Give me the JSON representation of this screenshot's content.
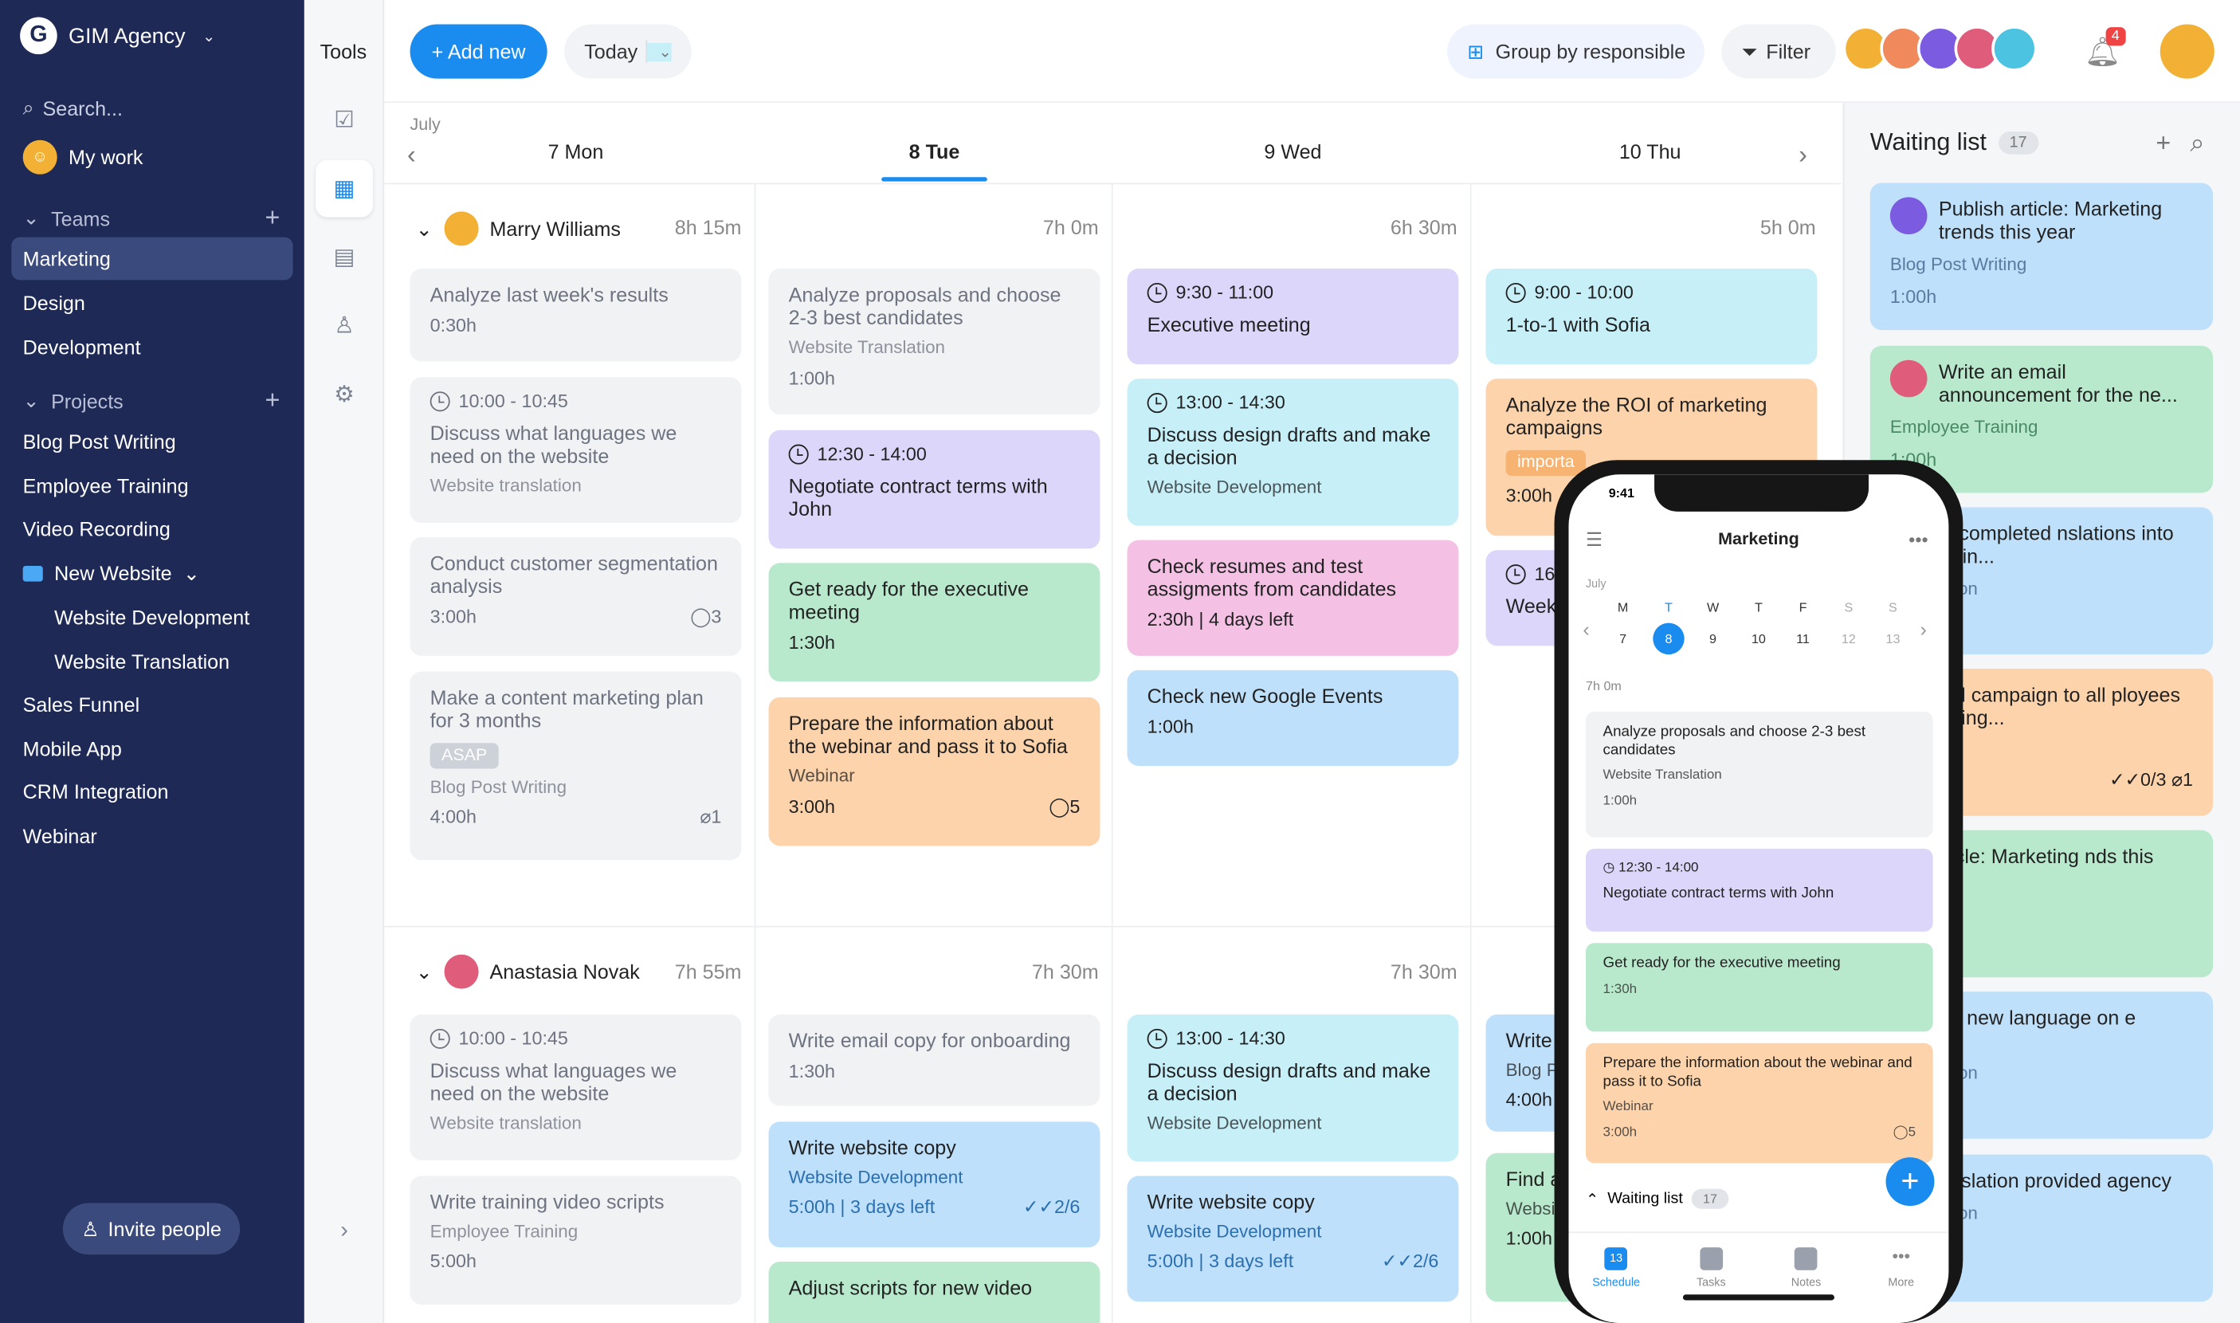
{
  "app": {
    "workspace": "GIM Agency",
    "search": "Search...",
    "my_work": "My work",
    "invite": "Invite people"
  },
  "sidebar": {
    "teams_label": "Teams",
    "teams": [
      "Marketing",
      "Design",
      "Development"
    ],
    "projects_label": "Projects",
    "projects": [
      "Blog Post Writing",
      "Employee Training",
      "Video Recording"
    ],
    "folder": "New Website",
    "folder_items": [
      "Website Development",
      "Website Translation"
    ],
    "projects2": [
      "Sales Funnel",
      "Mobile App",
      "CRM Integration",
      "Webinar"
    ]
  },
  "tools": {
    "label": "Tools"
  },
  "topbar": {
    "add": "+ Add new",
    "today": "Today",
    "group": "Group by responsible",
    "filter": "Filter",
    "notif": "4"
  },
  "calendar": {
    "month": "July",
    "days": [
      "7 Mon",
      "8 Tue",
      "9 Wed",
      "10 Thu"
    ],
    "people": [
      {
        "name": "Marry Williams",
        "total": "8h 15m",
        "day_hours": [
          "7h 0m",
          "6h 30m",
          "5h 0m"
        ]
      },
      {
        "name": "Anastasia Novak",
        "total": "7h 55m",
        "day_hours": [
          "7h 30m",
          "7h 30m"
        ]
      }
    ],
    "r1": {
      "c1": [
        {
          "title": "Analyze last week's results",
          "foot": "0:30h"
        },
        {
          "time": "10:00 - 10:45",
          "title": "Discuss what languages we need on the website",
          "sub": "Website translation"
        },
        {
          "title": "Conduct customer segmentation analysis",
          "foot": "3:00h",
          "comments": "3"
        },
        {
          "title": "Make a content marketing plan for 3 months",
          "tag": "ASAP",
          "sub": "Blog Post Writing",
          "foot": "4:00h",
          "att": "1"
        }
      ],
      "c2": [
        {
          "title": "Analyze proposals and choose 2-3 best candidates",
          "sub": "Website Translation",
          "foot": "1:00h"
        },
        {
          "time": "12:30 - 14:00",
          "title": "Negotiate contract terms with John"
        },
        {
          "title": "Get ready for the executive meeting",
          "foot": "1:30h"
        },
        {
          "title": "Prepare the information about the webinar and pass it to Sofia",
          "sub": "Webinar",
          "foot": "3:00h",
          "comments": "5"
        }
      ],
      "c3": [
        {
          "time": "9:30 - 11:00",
          "title": "Executive meeting"
        },
        {
          "time": "13:00 - 14:30",
          "title": "Discuss design drafts and make a decision",
          "sub": "Website Development"
        },
        {
          "title": "Check resumes and test assigments from candidates",
          "foot": "2:30h | 4 days left"
        },
        {
          "title": "Check new Google Events",
          "foot": "1:00h"
        }
      ],
      "c4": [
        {
          "time": "9:00 - 10:00",
          "title": "1-to-1 with Sofia"
        },
        {
          "title": "Analyze the ROI of marketing campaigns",
          "tag": "importa",
          "foot": "3:00h"
        },
        {
          "time": "16",
          "title": "Week"
        }
      ]
    },
    "r2": {
      "c1": [
        {
          "time": "10:00 - 10:45",
          "title": "Discuss what languages we need on the website",
          "sub": "Website translation"
        },
        {
          "title": "Write training video scripts",
          "sub": "Employee Training",
          "foot": "5:00h"
        }
      ],
      "c2": [
        {
          "title": "Write email copy for onboarding",
          "foot": "1:30h"
        },
        {
          "title": "Write website copy",
          "sub": "Website Development",
          "foot": "5:00h | 3 days left",
          "check": "2/6"
        },
        {
          "title": "Adjust scripts for new video"
        }
      ],
      "c3": [
        {
          "time": "13:00 - 14:30",
          "title": "Discuss design drafts and make a decision",
          "sub": "Website Development"
        },
        {
          "title": "Write website copy",
          "sub": "Website Development",
          "foot": "5:00h | 3 days left",
          "check": "2/6"
        }
      ],
      "c4": [
        {
          "title": "Write",
          "sub": "Blog P",
          "foot": "4:00h"
        },
        {
          "title": "Find a and ra",
          "sub": "Websi",
          "foot": "1:00h"
        }
      ]
    }
  },
  "waiting": {
    "title": "Waiting list",
    "count": "17",
    "items": [
      {
        "title": "Publish article: Marketing trends this year",
        "sub": "Blog Post Writing",
        "foot": "1:00h"
      },
      {
        "title": "Write an email announcement for the ne...",
        "sub": "Employee Training",
        "foot": "1:00h"
      },
      {
        "title": "load all completed nslations into the admin...",
        "sub": "Translation"
      },
      {
        "title": "nd email campaign to all ployees introducing...",
        "sub": "Training",
        "check": "0/3",
        "att": "1"
      },
      {
        "title": "eck article: Marketing nds this year",
        "sub": "t Writing"
      },
      {
        "title": "plement new language on e website",
        "sub": "Translation"
      },
      {
        "title": "eck translation provided agency",
        "sub": "Translation"
      }
    ]
  },
  "phone": {
    "time": "9:41",
    "title": "Marketing",
    "month": "July",
    "days": [
      "M",
      "T",
      "W",
      "T",
      "F",
      "S",
      "S"
    ],
    "nums": [
      "7",
      "8",
      "9",
      "10",
      "11",
      "12",
      "13"
    ],
    "hrs": "7h 0m",
    "cards": [
      {
        "title": "Analyze proposals and choose 2-3 best candidates",
        "sub": "Website Translation",
        "foot": "1:00h"
      },
      {
        "time": "12:30 - 14:00",
        "title": "Negotiate contract terms with John"
      },
      {
        "title": "Get ready for the executive meeting",
        "foot": "1:30h"
      },
      {
        "title": "Prepare the information about the webinar and pass it to Sofia",
        "sub": "Webinar",
        "foot": "3:00h",
        "comments": "5"
      }
    ],
    "wait": "Waiting list",
    "wait_count": "17",
    "tabs": [
      "Schedule",
      "Tasks",
      "Notes",
      "More"
    ],
    "tab_num": "13"
  },
  "colors": {
    "accent": "#1a8cf0",
    "sidebar": "#1e2a55"
  }
}
